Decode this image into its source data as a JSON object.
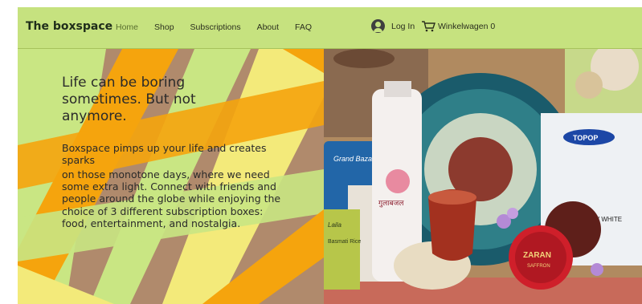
{
  "header": {
    "brand": "The boxspace",
    "nav": [
      {
        "label": "Home",
        "active": true
      },
      {
        "label": "Shop"
      },
      {
        "label": "Subscriptions"
      },
      {
        "label": "About"
      },
      {
        "label": "FAQ"
      }
    ],
    "login_label": "Log In",
    "cart_label": "Winkelwagen 0"
  },
  "hero": {
    "title": "Life can be boring sometimes. But not anymore.",
    "subtitle": "Boxspace pimps up your life and creates sparks",
    "body": "on those monotone days, where we need some extra light. Connect with friends and people around the globe while enjoying the choice of 3 different subscription boxes: food, entertainment, and nostalgia."
  },
  "products": {
    "bag_top": "Grand Bazaar",
    "bottle_label": "गुलाबजल",
    "bag_small": "Laila",
    "bag_small_sub": "Basmati Rice",
    "tin_brand": "ZARAN",
    "tin_sub": "SAFFRON",
    "noodle_brand": "TOPOP",
    "noodle_text": "A SEV WHITE"
  },
  "colors": {
    "topbar": "#c6e27f",
    "stripe_orange": "#f5a40d",
    "stripe_green": "#c9e683",
    "stripe_brown": "#b08a6c",
    "stripe_yellow": "#f3ea7a"
  }
}
